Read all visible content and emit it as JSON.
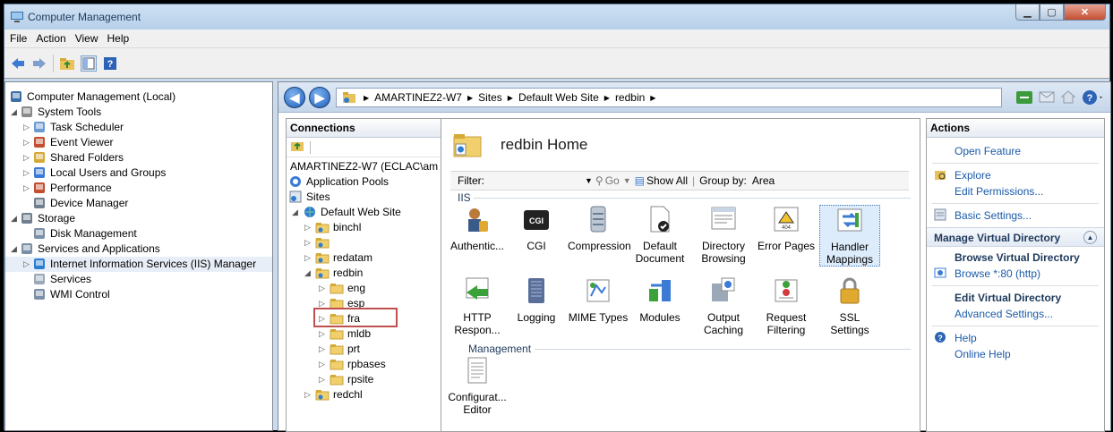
{
  "window": {
    "title": "Computer Management"
  },
  "menu": [
    "File",
    "Action",
    "View",
    "Help"
  ],
  "tree": [
    {
      "label": "Computer Management (Local)",
      "depth": 0
    },
    {
      "label": "System Tools",
      "depth": 1
    },
    {
      "label": "Task Scheduler",
      "depth": 2
    },
    {
      "label": "Event Viewer",
      "depth": 2
    },
    {
      "label": "Shared Folders",
      "depth": 2
    },
    {
      "label": "Local Users and Groups",
      "depth": 2
    },
    {
      "label": "Performance",
      "depth": 2
    },
    {
      "label": "Device Manager",
      "depth": 2
    },
    {
      "label": "Storage",
      "depth": 1
    },
    {
      "label": "Disk Management",
      "depth": 2
    },
    {
      "label": "Services and Applications",
      "depth": 1
    },
    {
      "label": "Internet Information Services (IIS) Manager",
      "depth": 2
    },
    {
      "label": "Services",
      "depth": 2
    },
    {
      "label": "WMI Control",
      "depth": 2
    }
  ],
  "breadcrumb": [
    "AMARTINEZ2-W7",
    "Sites",
    "Default Web Site",
    "redbin"
  ],
  "connections": {
    "header": "Connections",
    "items": [
      {
        "label": "AMARTINEZ2-W7 (ECLAC\\am",
        "depth": 0
      },
      {
        "label": "Application Pools",
        "depth": 0
      },
      {
        "label": "Sites",
        "depth": 0
      },
      {
        "label": "Default Web Site",
        "depth": 1
      },
      {
        "label": "binchl",
        "depth": 2
      },
      {
        "label": "",
        "depth": 2
      },
      {
        "label": "redatam",
        "depth": 2
      },
      {
        "label": "redbin",
        "depth": 2
      },
      {
        "label": "eng",
        "depth": 3
      },
      {
        "label": "esp",
        "depth": 3
      },
      {
        "label": "fra",
        "depth": 3
      },
      {
        "label": "mldb",
        "depth": 3
      },
      {
        "label": "prt",
        "depth": 3
      },
      {
        "label": "rpbases",
        "depth": 3
      },
      {
        "label": "rpsite",
        "depth": 3
      },
      {
        "label": "redchl",
        "depth": 2
      }
    ]
  },
  "home": {
    "title": "redbin Home",
    "filter_label": "Filter:",
    "go": "Go",
    "show_all": "Show All",
    "group_by": "Group by:",
    "group_value": "Area",
    "groups": {
      "iis": "IIS",
      "management": "Management"
    },
    "features_row1": [
      "Authentic...",
      "CGI",
      "Compression",
      "Default Document",
      "Directory Browsing",
      "Error Pages",
      "Handler Mappings"
    ],
    "features_row2": [
      "HTTP Respon...",
      "Logging",
      "MIME Types",
      "Modules",
      "Output Caching",
      "Request Filtering",
      "SSL Settings"
    ],
    "features_mgmt": [
      "Configurat... Editor"
    ]
  },
  "actions": {
    "header": "Actions",
    "open_feature": "Open Feature",
    "explore": "Explore",
    "edit_permissions": "Edit Permissions...",
    "basic_settings": "Basic Settings...",
    "manage_header": "Manage Virtual Directory",
    "browse_header": "Browse Virtual Directory",
    "browse": "Browse *:80 (http)",
    "edit_header": "Edit Virtual Directory",
    "advanced": "Advanced Settings...",
    "help": "Help",
    "online_help": "Online Help"
  },
  "colors": {
    "accent": "#1a5aa8",
    "highlight_box": "#c0504d",
    "arrow": "#c0504d"
  }
}
